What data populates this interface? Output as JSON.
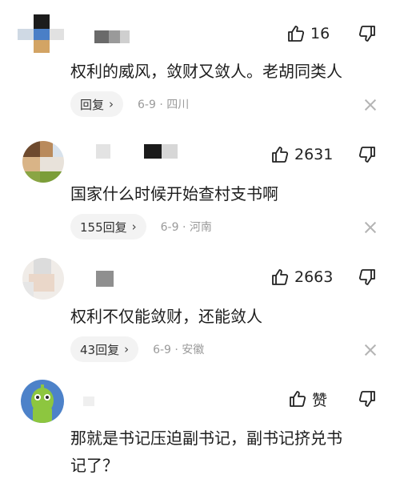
{
  "comments": [
    {
      "like_count": "16",
      "text": "权利的威风，敛财又敛人。老胡同类人",
      "reply_label": "回复",
      "date": "6-9",
      "location": "四川",
      "when": "6-9 · 四川"
    },
    {
      "like_count": "2631",
      "text": "国家什么时候开始查村支书啊",
      "reply_label": "155回复",
      "date": "6-9",
      "location": "河南",
      "when": "6-9 · 河南"
    },
    {
      "like_count": "2663",
      "text": "权利不仅能敛财，还能敛人",
      "reply_label": "43回复",
      "date": "6-9",
      "location": "安徽",
      "when": "6-9 · 安徽"
    },
    {
      "like_count": "赞",
      "text_line1": "那就是书记压迫副书记，副书记挤兑书",
      "text_line2": "记了？"
    }
  ],
  "icons": {
    "like": "thumb-up-icon",
    "dislike": "thumb-down-icon",
    "reply_chevron": "chevron-right-icon",
    "close": "close-icon"
  },
  "colors": {
    "reply_bg": "#f3f3f3",
    "meta_text": "#9a9a9a"
  }
}
